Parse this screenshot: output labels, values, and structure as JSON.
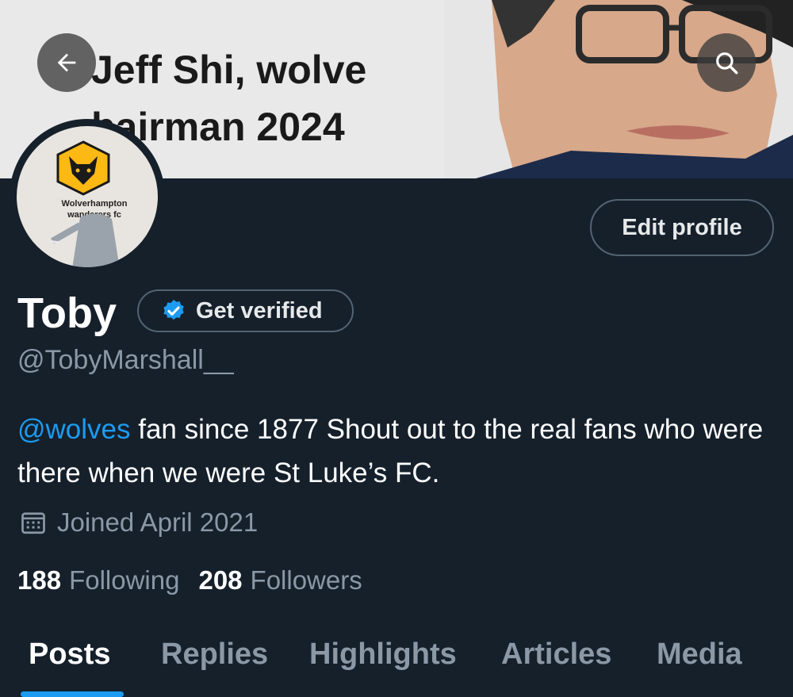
{
  "banner": {
    "text": "Jeff Shi, wolve\nhairman 2024"
  },
  "avatar": {
    "caption": "Wolverhampton\nwanderers fc"
  },
  "actions": {
    "edit_profile": "Edit profile"
  },
  "profile": {
    "name": "Toby",
    "get_verified": "Get verified",
    "handle": "@TobyMarshall__",
    "bio_mention": "@wolves",
    "bio_text": " fan since 1877 Shout out to the real fans who were there when we were St Luke’s FC.",
    "joined": "Joined April 2021"
  },
  "stats": {
    "following_count": "188",
    "following_label": "Following",
    "followers_count": "208",
    "followers_label": "Followers"
  },
  "tabs": [
    {
      "label": "Posts",
      "active": true
    },
    {
      "label": "Replies"
    },
    {
      "label": "Highlights"
    },
    {
      "label": "Articles"
    },
    {
      "label": "Media"
    }
  ],
  "colors": {
    "background": "#15202b",
    "accent": "#1d9bf0",
    "secondary_text": "#8b98a5",
    "border": "#536471"
  },
  "icons": [
    "back-arrow-icon",
    "search-icon",
    "verified-badge-icon",
    "calendar-icon",
    "wolves-logo-icon"
  ]
}
